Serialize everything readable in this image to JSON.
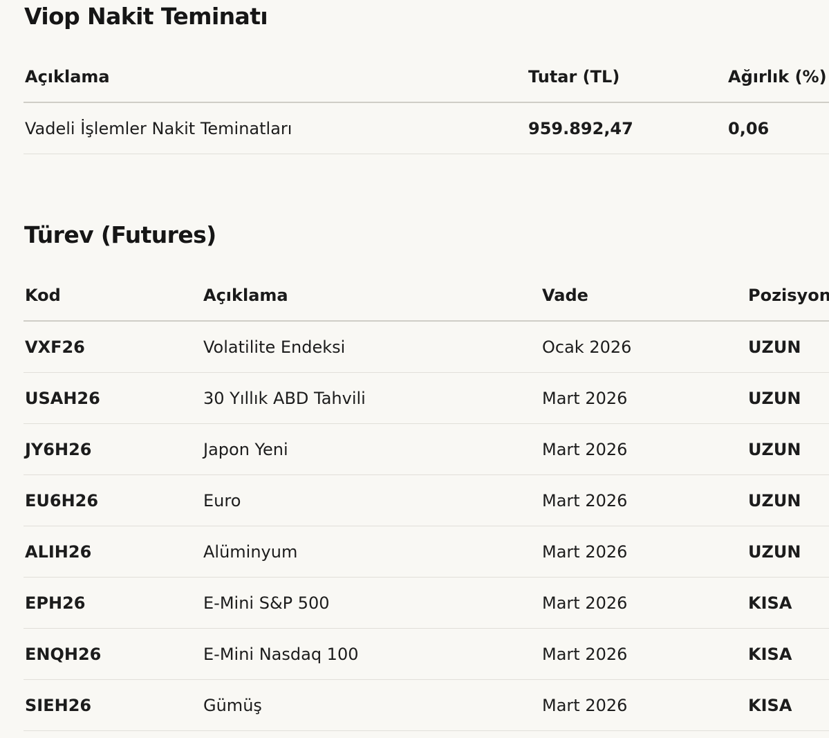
{
  "viop": {
    "title": "Viop Nakit Teminatı",
    "headers": [
      "Açıklama",
      "Tutar (TL)",
      "Ağırlık (%)"
    ],
    "rows": [
      [
        "Vadeli İşlemler Nakit Teminatları",
        "959.892,47",
        "0,06"
      ]
    ]
  },
  "futures": {
    "title": "Türev (Futures)",
    "headers": [
      "Kod",
      "Açıklama",
      "Vade",
      "Pozisyon"
    ],
    "rows": [
      [
        "VXF26",
        "Volatilite Endeksi",
        "Ocak 2026",
        "UZUN"
      ],
      [
        "USAH26",
        "30 Yıllık ABD Tahvili",
        "Mart 2026",
        "UZUN"
      ],
      [
        "JY6H26",
        "Japon Yeni",
        "Mart 2026",
        "UZUN"
      ],
      [
        "EU6H26",
        "Euro",
        "Mart 2026",
        "UZUN"
      ],
      [
        "ALIH26",
        "Alüminyum",
        "Mart 2026",
        "UZUN"
      ],
      [
        "EPH26",
        "E-Mini S&P 500",
        "Mart 2026",
        "KISA"
      ],
      [
        "ENQH26",
        "E-Mini Nasdaq 100",
        "Mart 2026",
        "KISA"
      ],
      [
        "SIEH26",
        "Gümüş",
        "Mart 2026",
        "KISA"
      ]
    ]
  }
}
